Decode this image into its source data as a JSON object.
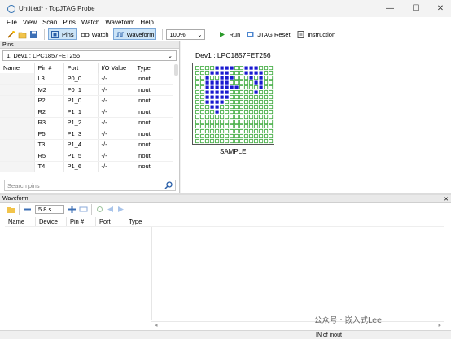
{
  "window": {
    "title": "Untitled* - TopJTAG Probe",
    "minimize": "—",
    "maximize": "☐",
    "close": "✕"
  },
  "menu": [
    "File",
    "View",
    "Scan",
    "Pins",
    "Watch",
    "Waveform",
    "Help"
  ],
  "toolbar": {
    "pins_label": "Pins",
    "watch_label": "Watch",
    "waveform_label": "Waveform",
    "zoom_value": "100%",
    "run_label": "Run",
    "jtag_reset_label": "JTAG Reset",
    "instruction_label": "Instruction"
  },
  "pins_panel": {
    "header": "Pins",
    "device_select": "1.  Dev1 : LPC1857FET256",
    "columns": [
      "Name",
      "Pin #",
      "Port",
      "I/O Value",
      "Type"
    ],
    "rows": [
      {
        "name": "",
        "pin": "L3",
        "port": "P0_0",
        "io": "-/-",
        "type": "inout"
      },
      {
        "name": "",
        "pin": "M2",
        "port": "P0_1",
        "io": "-/-",
        "type": "inout"
      },
      {
        "name": "",
        "pin": "P2",
        "port": "P1_0",
        "io": "-/-",
        "type": "inout"
      },
      {
        "name": "",
        "pin": "R2",
        "port": "P1_1",
        "io": "-/-",
        "type": "inout"
      },
      {
        "name": "",
        "pin": "R3",
        "port": "P1_2",
        "io": "-/-",
        "type": "inout"
      },
      {
        "name": "",
        "pin": "P5",
        "port": "P1_3",
        "io": "-/-",
        "type": "inout"
      },
      {
        "name": "",
        "pin": "T3",
        "port": "P1_4",
        "io": "-/-",
        "type": "inout"
      },
      {
        "name": "",
        "pin": "R5",
        "port": "P1_5",
        "io": "-/-",
        "type": "inout"
      },
      {
        "name": "",
        "pin": "T4",
        "port": "P1_6",
        "io": "-/-",
        "type": "inout"
      }
    ],
    "search_placeholder": "Search pins"
  },
  "device_view": {
    "title": "Dev1 : LPC1857FET256",
    "chip_label": "SAMPLE",
    "grid_size": 16,
    "color_active": "#1a1ad0",
    "color_idle": "#3aa83a",
    "active_rows": [
      [
        4,
        5,
        6,
        7,
        10,
        11,
        12
      ],
      [
        3,
        4,
        5,
        6,
        10,
        11,
        12,
        13
      ],
      [
        2,
        5,
        6,
        7,
        11,
        13
      ],
      [
        2,
        3,
        4,
        5,
        6,
        12,
        13
      ],
      [
        2,
        3,
        4,
        5,
        6,
        7,
        8,
        13
      ],
      [
        2,
        3,
        4,
        5,
        6,
        12
      ],
      [
        2,
        3,
        4,
        5,
        6
      ],
      [
        2,
        3,
        4,
        5
      ],
      [
        3,
        4
      ],
      [
        4
      ],
      [],
      [],
      [],
      [],
      [],
      []
    ]
  },
  "waveform_panel": {
    "header": "Waveform",
    "time_value": "5.8 s",
    "columns": [
      "Name",
      "Device",
      "Pin #",
      "Port",
      "Type"
    ]
  },
  "status": {
    "text": "IN of inout"
  },
  "watermark": "公众号 · 嵌入式Lee"
}
